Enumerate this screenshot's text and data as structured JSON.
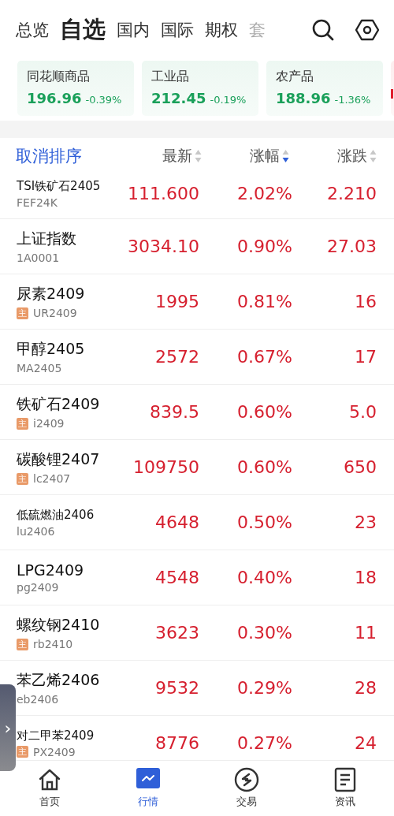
{
  "tabs": [
    {
      "label": "总览",
      "selected": false
    },
    {
      "label": "自选",
      "selected": true
    },
    {
      "label": "国内",
      "selected": false
    },
    {
      "label": "国际",
      "selected": false
    },
    {
      "label": "期权",
      "selected": false
    },
    {
      "label": "套",
      "selected": false
    }
  ],
  "index_cards": [
    {
      "name": "同花顺商品",
      "value": "196.96",
      "change": "-0.39%",
      "color": "#1aa05a"
    },
    {
      "name": "工业品",
      "value": "212.45",
      "change": "-0.19%",
      "color": "#1aa05a"
    },
    {
      "name": "农产品",
      "value": "188.96",
      "change": "-1.36%",
      "color": "#1aa05a"
    },
    {
      "color": "#e0202f"
    }
  ],
  "table": {
    "cancel_sort": "取消排序",
    "columns": [
      {
        "label": "最新",
        "sorted": false
      },
      {
        "label": "涨幅",
        "sorted": true
      },
      {
        "label": "涨跌",
        "sorted": false
      }
    ],
    "rows": [
      {
        "name": "TSI铁矿石2405",
        "code": "FEF24K",
        "price": "111.600",
        "pct": "2.02%",
        "change": "2.210"
      },
      {
        "name": "上证指数",
        "code": "1A0001",
        "price": "3034.10",
        "pct": "0.90%",
        "change": "27.03"
      },
      {
        "name": "尿素2409",
        "badge": "主",
        "code": "UR2409",
        "price": "1995",
        "pct": "0.81%",
        "change": "16"
      },
      {
        "name": "甲醇2405",
        "code": "MA2405",
        "price": "2572",
        "pct": "0.67%",
        "change": "17"
      },
      {
        "name": "铁矿石2409",
        "badge": "主",
        "code": "i2409",
        "price": "839.5",
        "pct": "0.60%",
        "change": "5.0"
      },
      {
        "name": "碳酸锂2407",
        "badge": "主",
        "code": "lc2407",
        "price": "109750",
        "pct": "0.60%",
        "change": "650"
      },
      {
        "name": "低硫燃油2406",
        "code": "lu2406",
        "price": "4648",
        "pct": "0.50%",
        "change": "23"
      },
      {
        "name": "LPG2409",
        "code": "pg2409",
        "price": "4548",
        "pct": "0.40%",
        "change": "18"
      },
      {
        "name": "螺纹钢2410",
        "badge": "主",
        "code": "rb2410",
        "price": "3623",
        "pct": "0.30%",
        "change": "11"
      },
      {
        "name": "苯乙烯2406",
        "code": "eb2406",
        "price": "9532",
        "pct": "0.29%",
        "change": "28"
      },
      {
        "name": "对二甲苯2409",
        "badge": "主",
        "code": "PX2409",
        "price": "8776",
        "pct": "0.27%",
        "change": "24"
      }
    ]
  },
  "side_tab": {
    "glyph": "›"
  },
  "nav": [
    {
      "label": "首页",
      "selected": false
    },
    {
      "label": "行情",
      "selected": true
    },
    {
      "label": "交易",
      "selected": false
    },
    {
      "label": "资讯",
      "selected": false
    }
  ]
}
